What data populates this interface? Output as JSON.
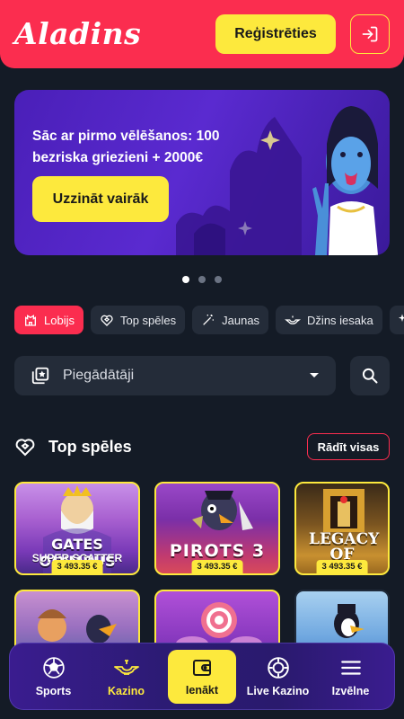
{
  "header": {
    "logo_text": "Aladins",
    "register_label": "Reģistrēties"
  },
  "banner": {
    "headline": "Sāc ar pirmo vēlēšanos: 100 bezriska griezieni + 2000€",
    "cta_label": "Uzzināt vairāk",
    "pages": 3,
    "active_page": 1
  },
  "chips": [
    {
      "label": "Lobijs",
      "icon": "castle-icon",
      "active": true
    },
    {
      "label": "Top spēles",
      "icon": "heart-diamond-icon",
      "active": false
    },
    {
      "label": "Jaunas",
      "icon": "magic-wand-icon",
      "active": false
    },
    {
      "label": "Džins iesaka",
      "icon": "genie-lamp-icon",
      "active": false
    }
  ],
  "providers": {
    "label": "Piegādātāji"
  },
  "section": {
    "title": "Top spēles",
    "show_all_label": "Rādīt visas"
  },
  "games": [
    {
      "title": "GATES OLYMPUS",
      "subtitle": "SUPER SCATTER",
      "jackpot": "3 493.35 €"
    },
    {
      "title": "PIROTS 3",
      "subtitle": "",
      "jackpot": "3 493.35 €"
    },
    {
      "title": "LEGACY OF DEAD",
      "subtitle": "",
      "jackpot": "3 493.35 €"
    },
    {
      "title": "",
      "subtitle": "",
      "jackpot": ""
    },
    {
      "title": "",
      "subtitle": "",
      "jackpot": ""
    },
    {
      "title": "",
      "subtitle": "",
      "jackpot": ""
    }
  ],
  "bottom_nav": [
    {
      "label": "Sports",
      "icon": "soccer-ball-icon"
    },
    {
      "label": "Kazino",
      "icon": "genie-lamp-icon"
    },
    {
      "label": "Ienākt",
      "icon": "wallet-icon"
    },
    {
      "label": "Live Kazino",
      "icon": "casino-chip-icon"
    },
    {
      "label": "Izvēlne",
      "icon": "hamburger-menu-icon"
    }
  ],
  "colors": {
    "brand_red": "#fb2d4f",
    "brand_yellow": "#fde93d",
    "background": "#141b26",
    "surface": "#242c39"
  }
}
